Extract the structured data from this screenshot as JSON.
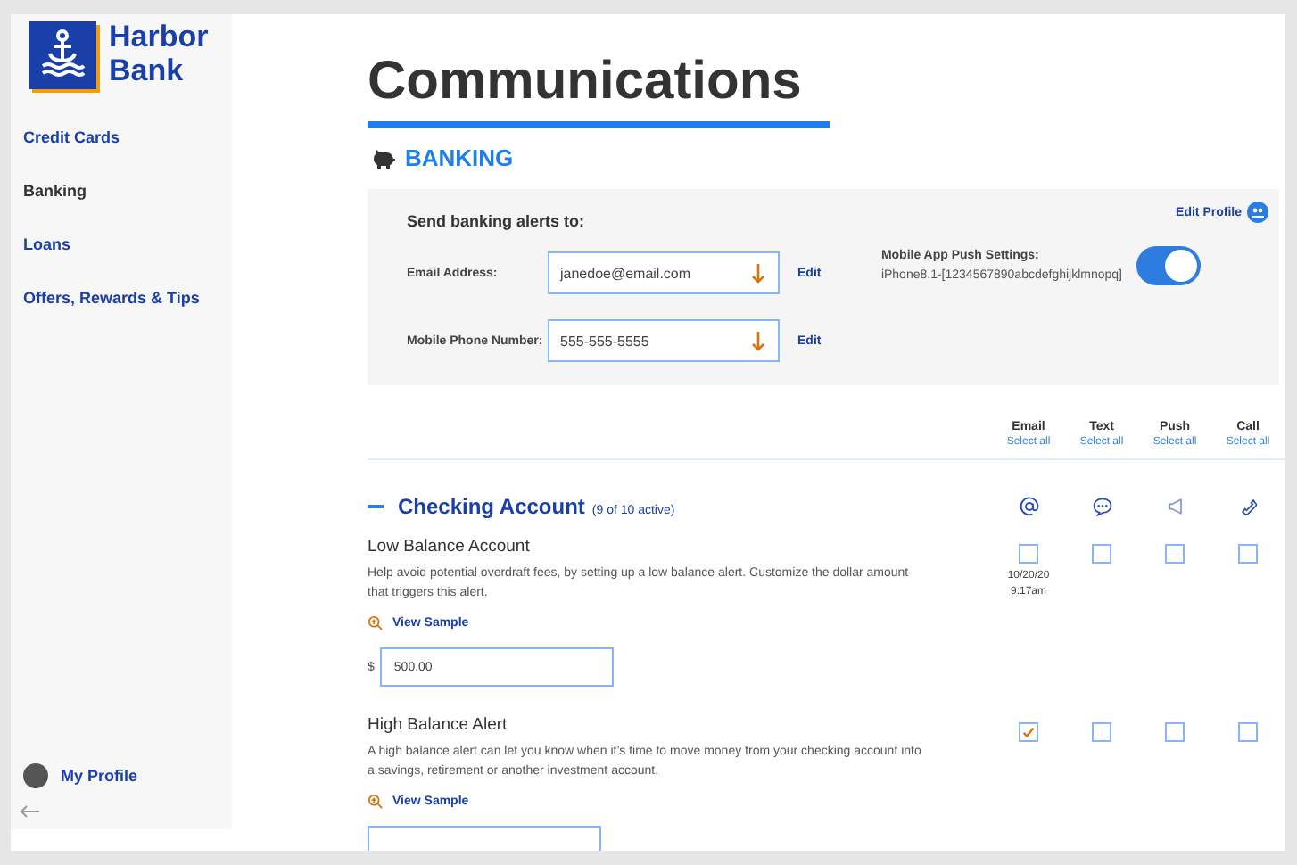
{
  "brand": {
    "name": "Harbor Bank"
  },
  "sidebar": {
    "items": [
      {
        "label": "Credit Cards",
        "selected": false
      },
      {
        "label": "Banking",
        "selected": true
      },
      {
        "label": "Loans",
        "selected": false
      },
      {
        "label": "Offers, Rewards & Tips",
        "selected": false
      }
    ],
    "profile": {
      "label": "My Profile"
    }
  },
  "page_title": "Communications",
  "section_title": "BANKING",
  "contact_panel": {
    "heading": "Send banking alerts to:",
    "edit_profile": "Edit Profile",
    "fields": [
      {
        "label": "Email Address:",
        "value": "janedoe@email.com",
        "action": "Edit"
      },
      {
        "label": "Mobile Phone Number:",
        "value": "555-555-5555",
        "action": "Edit"
      }
    ],
    "push": {
      "label": "Mobile App Push Settings:",
      "device": "iPhone8.1-[1234567890abcdefghijklmnopq]",
      "on": true
    }
  },
  "columns": [
    {
      "label": "Email",
      "action": "Select all",
      "kind": "email"
    },
    {
      "label": "Text",
      "action": "Select all",
      "kind": "text"
    },
    {
      "label": "Push",
      "action": "Select all",
      "kind": "push"
    },
    {
      "label": "Call",
      "action": "Select all",
      "kind": "call"
    }
  ],
  "group": {
    "title": "Checking Account",
    "count": "(9 of 10 active)",
    "expanded": true,
    "alerts": [
      {
        "title": "Low Balance Account",
        "description": "Help avoid potential overdraft fees, by setting up a low balance alert. Customize the dollar amount that triggers this alert.",
        "link": "View Sample",
        "currency": "$",
        "amount": "500.00",
        "checks": [
          {
            "checked": false,
            "note": [
              "10/20/20",
              "9:17am"
            ]
          },
          {
            "checked": false
          },
          {
            "checked": false
          },
          {
            "checked": false
          }
        ]
      },
      {
        "title": "High Balance Alert",
        "description": "A high balance alert can let you know when it’s time to move money from your checking account into a savings, retirement or another investment account.",
        "link": "View Sample",
        "checks": [
          {
            "checked": true
          },
          {
            "checked": false
          },
          {
            "checked": false
          },
          {
            "checked": false
          }
        ]
      }
    ]
  }
}
